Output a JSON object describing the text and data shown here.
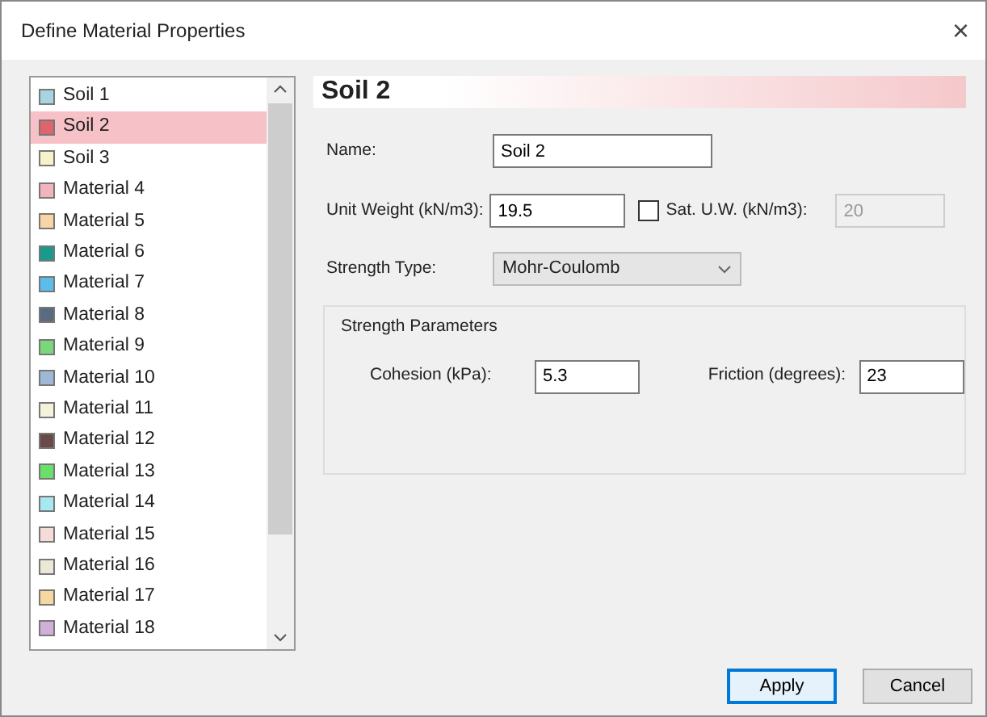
{
  "window": {
    "title": "Define Material Properties",
    "close": "×"
  },
  "materials": [
    {
      "name": "Soil 1",
      "color": "#a8d4e0",
      "selected": false
    },
    {
      "name": "Soil 2",
      "color": "#e0646e",
      "selected": true
    },
    {
      "name": "Soil 3",
      "color": "#f7f3c8",
      "selected": false
    },
    {
      "name": "Material 4",
      "color": "#f2b4be",
      "selected": false
    },
    {
      "name": "Material 5",
      "color": "#f8d4a6",
      "selected": false
    },
    {
      "name": "Material 6",
      "color": "#1a9a8a",
      "selected": false
    },
    {
      "name": "Material 7",
      "color": "#5bbde8",
      "selected": false
    },
    {
      "name": "Material 8",
      "color": "#5a6a80",
      "selected": false
    },
    {
      "name": "Material 9",
      "color": "#7ad87a",
      "selected": false
    },
    {
      "name": "Material 10",
      "color": "#a0b8d8",
      "selected": false
    },
    {
      "name": "Material 11",
      "color": "#f5f2dc",
      "selected": false
    },
    {
      "name": "Material 12",
      "color": "#6a4a48",
      "selected": false
    },
    {
      "name": "Material 13",
      "color": "#6ae06a",
      "selected": false
    },
    {
      "name": "Material 14",
      "color": "#a8e8f0",
      "selected": false
    },
    {
      "name": "Material 15",
      "color": "#f5dcd8",
      "selected": false
    },
    {
      "name": "Material 16",
      "color": "#ece8d8",
      "selected": false
    },
    {
      "name": "Material 17",
      "color": "#f5d8a0",
      "selected": false
    },
    {
      "name": "Material 18",
      "color": "#d0b0d8",
      "selected": false
    }
  ],
  "heading": "Soil 2",
  "name_label": "Name:",
  "name_value": "Soil 2",
  "unit_weight_label": "Unit Weight (kN/m3):",
  "unit_weight_value": "19.5",
  "sat_uw": {
    "label": "Sat. U.W. (kN/m3):",
    "checked": false,
    "value": "20",
    "disabled": true
  },
  "strength_type_label": "Strength Type:",
  "strength_type_value": "Mohr-Coulomb",
  "strength_parameters": {
    "title": "Strength Parameters",
    "cohesion_label": "Cohesion (kPa):",
    "cohesion_value": "5.3",
    "friction_label": "Friction (degrees):",
    "friction_value": "23"
  },
  "buttons": [
    {
      "label": "Apply",
      "default": true
    },
    {
      "label": "Cancel",
      "default": false
    }
  ]
}
